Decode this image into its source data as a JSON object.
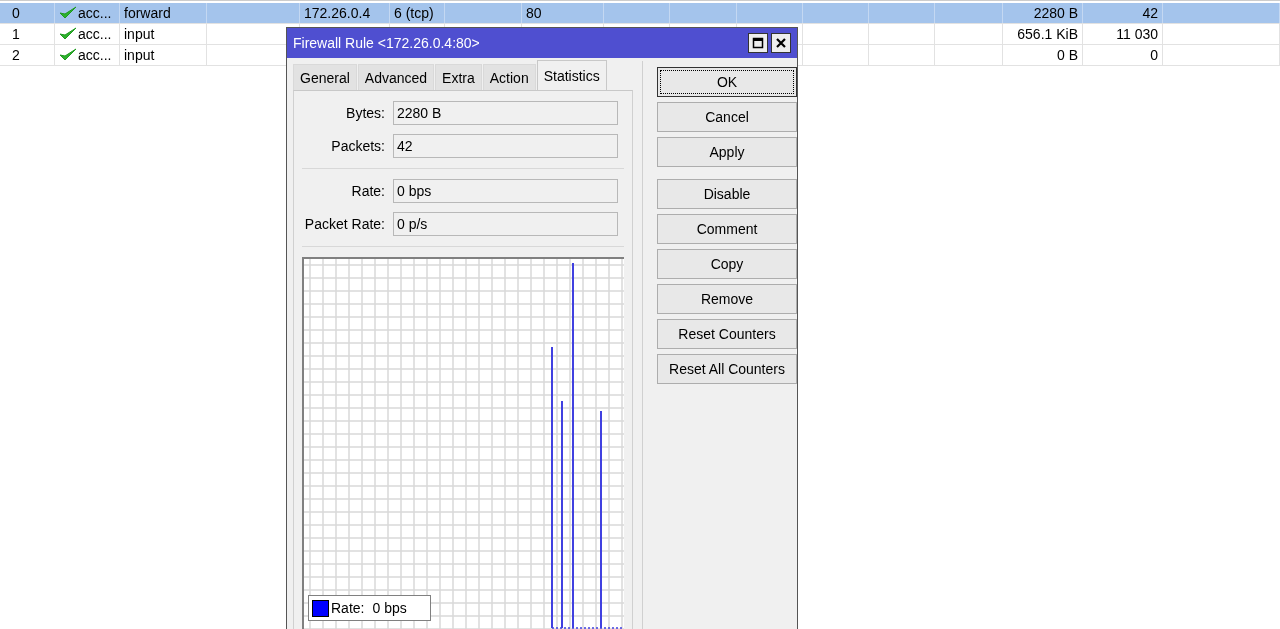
{
  "table": {
    "rows": [
      {
        "number": "0",
        "action": "acc...",
        "chain": "forward",
        "dst_address": "172.26.0.4",
        "protocol": "6 (tcp)",
        "dst_port": "80",
        "bytes": "2280 B",
        "packets": "42",
        "selected": true
      },
      {
        "number": "1",
        "action": "acc...",
        "chain": "input",
        "bytes": "656.1 KiB",
        "packets": "11 030",
        "selected": false
      },
      {
        "number": "2",
        "action": "acc...",
        "chain": "input",
        "bytes": "0 B",
        "packets": "0",
        "selected": false
      }
    ]
  },
  "dialog": {
    "title": "Firewall Rule <172.26.0.4:80>",
    "tabs": [
      {
        "label": "General",
        "selected": false
      },
      {
        "label": "Advanced",
        "selected": false
      },
      {
        "label": "Extra",
        "selected": false
      },
      {
        "label": "Action",
        "selected": false
      },
      {
        "label": "Statistics",
        "selected": true
      }
    ],
    "stat_groups": [
      [
        {
          "label": "Bytes:",
          "value": "2280 B"
        },
        {
          "label": "Packets:",
          "value": "42"
        }
      ],
      [
        {
          "label": "Rate:",
          "value": "0 bps"
        },
        {
          "label": "Packet Rate:",
          "value": "0 p/s"
        }
      ]
    ],
    "graph": {
      "legend_label": "Rate:",
      "legend_value": "0 bps"
    },
    "button_groups": [
      [
        {
          "label": "OK",
          "focused": true
        },
        {
          "label": "Cancel",
          "focused": false
        },
        {
          "label": "Apply",
          "focused": false
        }
      ],
      [
        {
          "label": "Disable",
          "focused": false
        },
        {
          "label": "Comment",
          "focused": false
        },
        {
          "label": "Copy",
          "focused": false
        },
        {
          "label": "Remove",
          "focused": false
        },
        {
          "label": "Reset Counters",
          "focused": false
        },
        {
          "label": "Reset All Counters",
          "focused": false
        }
      ]
    ]
  }
}
